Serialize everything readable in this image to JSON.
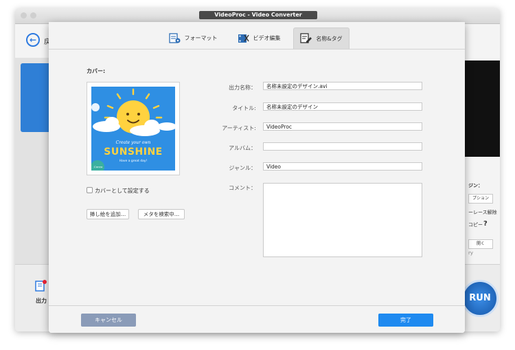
{
  "app": {
    "title": "VideoProc - Video Converter"
  },
  "background": {
    "back_partial": "戻",
    "output_label": "出力",
    "run_label": "RUN",
    "side_title": "ジン：",
    "side_btn1": "プション",
    "side_text1": "ーレース解除",
    "side_text2": "コピー",
    "side_help": "?",
    "side_btn2": "開く",
    "side_text3": "ry"
  },
  "tabs": [
    {
      "label": "フォーマット",
      "icon": "format-icon",
      "active": false
    },
    {
      "label": "ビデオ編集",
      "icon": "video-edit-icon",
      "active": false
    },
    {
      "label": "名称&タグ",
      "icon": "name-tag-icon",
      "active": true
    }
  ],
  "cover": {
    "heading": "カバー:",
    "image_text_top": "Create your own",
    "image_text_main": "SUNSHINE",
    "image_text_sub": "Have a great day!",
    "image_logo": "Canva",
    "set_cover_label": "カバーとして設定する",
    "set_cover_checked": false,
    "add_image_button": "挿し絵を追加…",
    "search_meta_button": "メタを検索中…"
  },
  "form": {
    "output_name_label": "出力名称：",
    "output_name_value": "名称未設定のデザイン.avi",
    "title_label": "タイトル:",
    "title_value": "名称未設定のデザイン",
    "artist_label": "アーティスト:",
    "artist_value": "VideoProc",
    "album_label": "アルバム：",
    "album_value": "",
    "genre_label": "ジャンル：",
    "genre_value": "Video",
    "comment_label": "コメント：",
    "comment_value": ""
  },
  "footer": {
    "cancel_label": "キャンセル",
    "done_label": "完了"
  },
  "colors": {
    "accent": "#1e8af0",
    "cancel": "#8a9bb8",
    "sky": "#2f8fe3",
    "sun": "#ffd23f"
  }
}
